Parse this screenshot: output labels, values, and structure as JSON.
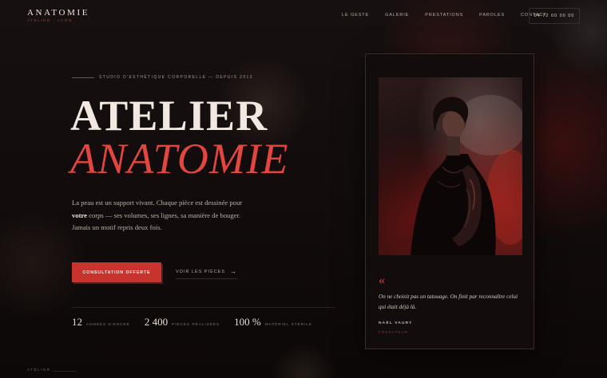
{
  "brand": {
    "name": "ANATOMIE",
    "subtitle": "ATELIER · LYON"
  },
  "nav": {
    "items": [
      "LE GESTE",
      "GALERIE",
      "PRESTATIONS",
      "PAROLES",
      "CONTACT"
    ],
    "phone": "04 72 00 00 00"
  },
  "hero": {
    "eyebrow": "STUDIO D'ESTHÉTIQUE CORPORELLE — DEPUIS 2013",
    "title_line1": "ATELIER",
    "title_line2": "ANATOMIE",
    "lead_part1": "La peau est un support vivant. Chaque pièce est dessinée pour",
    "lead_emphasis": "votre",
    "lead_part2": "corps — ses volumes, ses lignes, sa manière de bouger. Jamais un motif repris deux fois.",
    "cta_label": "CONSULTATION OFFERTE",
    "secondary_link": "VOIR LES PIÈCES",
    "secondary_arrow": "→"
  },
  "stats": [
    {
      "value": "12",
      "label": "ANNÉES D'ENCRE"
    },
    {
      "value": "2 400",
      "label": "PIÈCES RÉALISÉES"
    },
    {
      "value": "100 %",
      "label": "MATÉRIEL STÉRILE"
    }
  ],
  "testimonial": {
    "quote_mark": "«",
    "quote": "On ne choisit pas un tatouage. On finit par reconnaître celui qui était déjà là.",
    "author": "NAËL VAURY",
    "role": "FONDATEUR",
    "image_alt": "portrait-tattooed-person-red-smoke"
  },
  "footer": {
    "label": "ATELIER"
  },
  "colors": {
    "accent": "#c8342d",
    "title_accent": "#e2463e",
    "background": "#120c0c"
  }
}
